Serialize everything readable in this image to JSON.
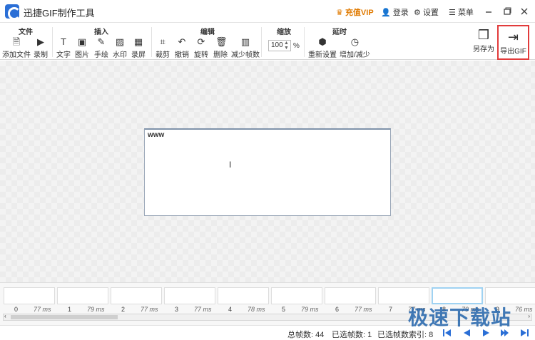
{
  "app": {
    "title": "迅捷GIF制作工具"
  },
  "topbar": {
    "vip": "充值VIP",
    "login": "登录",
    "settings": "设置",
    "menu": "菜单"
  },
  "groups": {
    "file": "文件",
    "insert": "插入",
    "edit": "编辑",
    "zoom": "缩放",
    "delay": "延时"
  },
  "tools": {
    "add_file": "添加文件",
    "record": "录制",
    "text": "文字",
    "image": "图片",
    "draw": "手绘",
    "watermark": "水印",
    "screen": "录屏",
    "crop": "裁剪",
    "undo": "撤销",
    "rotate": "旋转",
    "delete": "删除",
    "reduce_frames": "减少帧数",
    "reset": "重新设置",
    "increase_decrease": "增加/减少",
    "save_as": "另存为",
    "export_gif": "导出GIF"
  },
  "zoom": {
    "value": "100",
    "unit": "%"
  },
  "frame_text": "www",
  "frames": [
    {
      "index": "0",
      "ms": "77 ms"
    },
    {
      "index": "1",
      "ms": "79 ms"
    },
    {
      "index": "2",
      "ms": "77 ms"
    },
    {
      "index": "3",
      "ms": "77 ms"
    },
    {
      "index": "4",
      "ms": "78 ms"
    },
    {
      "index": "5",
      "ms": "79 ms"
    },
    {
      "index": "6",
      "ms": "77 ms"
    },
    {
      "index": "7",
      "ms": "77 ms"
    },
    {
      "index": "8",
      "ms": "79 ms"
    },
    {
      "index": "9",
      "ms": "76 ms"
    }
  ],
  "status": {
    "total": "总帧数: 44",
    "selected": "已选帧数: 1",
    "selected_index": "已选帧数索引: 8"
  },
  "watermark": "极速下载站",
  "colors": {
    "accent": "#2b6fd6",
    "export_border": "#e23b3b",
    "vip": "#e07a00"
  }
}
